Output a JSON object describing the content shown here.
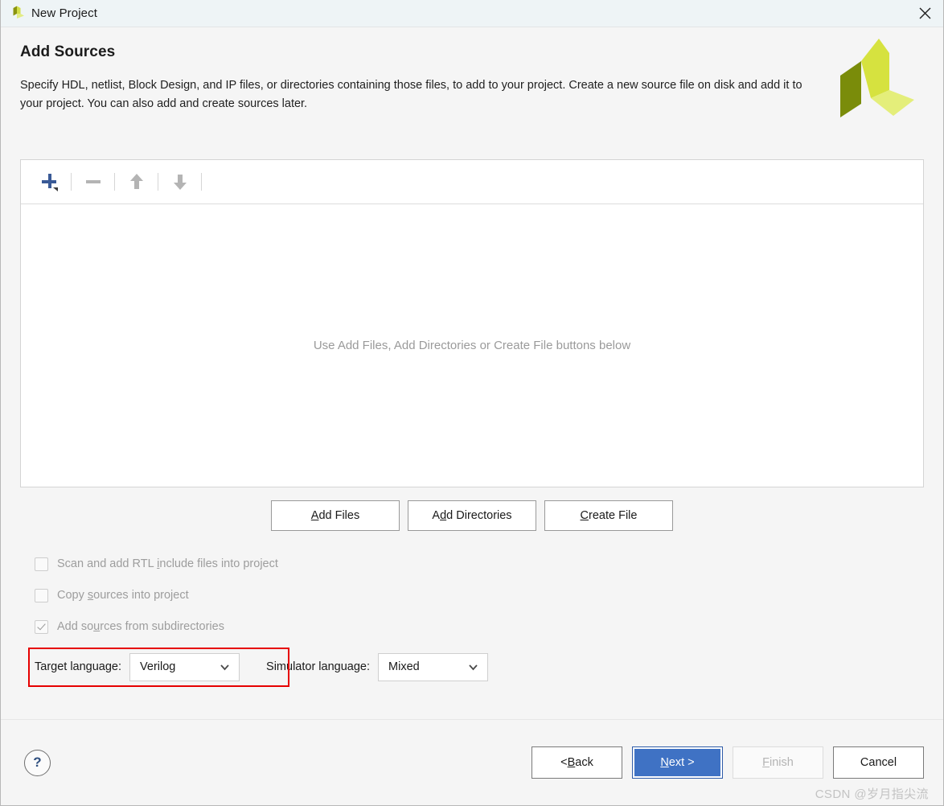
{
  "window": {
    "title": "New Project",
    "logo_icon": "xilinx-vivado-logo",
    "close_icon": "close-icon"
  },
  "header": {
    "title": "Add Sources",
    "description": "Specify HDL, netlist, Block Design, and IP files, or directories containing those files, to add to your project. Create a new source file on disk and add it to your project. You can also add and create sources later.",
    "brand_logo_icon": "xilinx-logo"
  },
  "sources_panel": {
    "toolbar": [
      {
        "name": "add-button",
        "icon": "plus-icon",
        "enabled": true
      },
      {
        "name": "remove-button",
        "icon": "minus-icon",
        "enabled": false
      },
      {
        "name": "move-up-button",
        "icon": "arrow-up-icon",
        "enabled": false
      },
      {
        "name": "move-down-button",
        "icon": "arrow-down-icon",
        "enabled": false
      }
    ],
    "empty_hint": "Use Add Files, Add Directories or Create File buttons below"
  },
  "actions": {
    "add_files": {
      "pre": "A",
      "mnemonic": "",
      "label": "Add Files",
      "m_index": 0
    },
    "add_directories": {
      "label": "Add Directories"
    },
    "create_file": {
      "label": "Create File"
    }
  },
  "action_buttons": [
    {
      "name": "add-files-button",
      "before": "",
      "mnemonic": "A",
      "after": "dd Files"
    },
    {
      "name": "add-directories-button",
      "before": "A",
      "mnemonic": "d",
      "after": "d Directories"
    },
    {
      "name": "create-file-button",
      "before": "",
      "mnemonic": "C",
      "after": "reate File"
    }
  ],
  "checkboxes": [
    {
      "name": "scan-rtl-include-checkbox",
      "before": "Scan and add RTL ",
      "mnemonic": "i",
      "after": "nclude files into project",
      "checked": false,
      "enabled": false
    },
    {
      "name": "copy-sources-checkbox",
      "before": "Copy ",
      "mnemonic": "s",
      "after": "ources into project",
      "checked": false,
      "enabled": false
    },
    {
      "name": "add-subdirectories-checkbox",
      "before": "Add so",
      "mnemonic": "u",
      "after": "rces from subdirectories",
      "checked": true,
      "enabled": false
    }
  ],
  "language": {
    "target_label": "Target language:",
    "target_value": "Verilog",
    "simulator_label": "Simulator language:",
    "simulator_value": "Mixed",
    "highlight_color": "#e60000"
  },
  "footer": {
    "help_label": "?",
    "back": {
      "before": "< ",
      "mnemonic": "B",
      "after": "ack"
    },
    "next": {
      "before": "",
      "mnemonic": "N",
      "after": "ext >"
    },
    "finish": {
      "before": "",
      "mnemonic": "F",
      "after": "inish"
    },
    "cancel": {
      "before": "Cancel",
      "mnemonic": "",
      "after": ""
    }
  },
  "watermark": "CSDN @岁月指尖流",
  "colors": {
    "titlebar": "#eef4f6",
    "dialog_bg": "#f5f5f5",
    "primary_button": "#3f72c4",
    "logo_dark": "#7a8c0a",
    "logo_mid": "#d6e23f",
    "logo_light": "#e4ee7a"
  }
}
